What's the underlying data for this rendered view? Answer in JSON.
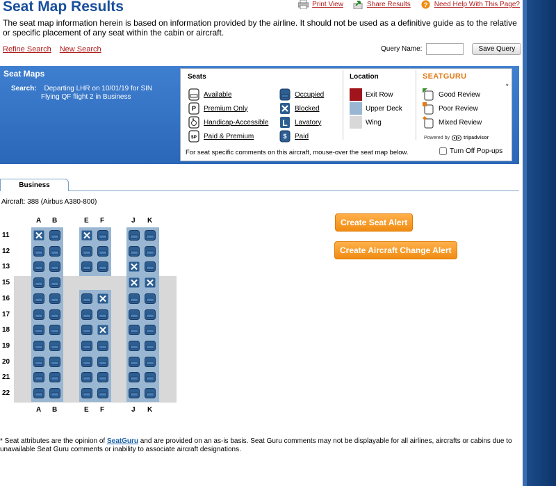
{
  "page": {
    "title": "Seat Map Results",
    "intro": "The seat map information herein is based on information provided by the airline. It should not be used as a definitive guide as to the relative or specific placement of any seat within the cabin or aircraft."
  },
  "top_links": {
    "print": "Print View",
    "share": "Share Results",
    "help": "Need Help With This Page?"
  },
  "search_links": {
    "refine": "Refine Search",
    "new": "New Search"
  },
  "query": {
    "label": "Query Name:",
    "value": "",
    "save": "Save Query"
  },
  "banner": {
    "heading": "Seat Maps",
    "search_label": "Search:",
    "search_line1": "Departing LHR on 10/01/19 for SIN",
    "search_line2": "Flying QF flight 2 in Business"
  },
  "legend": {
    "seats_header": "Seats",
    "location_header": "Location",
    "seats_col1": [
      "Available",
      "Premium Only",
      "Handicap-Accessible",
      "Paid & Premium"
    ],
    "seats_col2": [
      "Occupied",
      "Blocked",
      "Lavatory",
      "Paid"
    ],
    "locations": [
      "Exit Row",
      "Upper Deck",
      "Wing"
    ],
    "location_colors": [
      "#a0141c",
      "#99b6d2",
      "#d8d8d8"
    ],
    "seatguru_logo": "SEATGURU",
    "reviews": [
      "Good Review",
      "Poor Review",
      "Mixed Review"
    ],
    "review_colors": [
      "#3c8f2e",
      "#e07b1a",
      "#e07b1a"
    ],
    "powered_by": "Powered by",
    "tripadvisor": "tripadvisor",
    "asterisk": "*",
    "footer": "For seat specific comments on this aircraft, mouse-over the seat map below.",
    "popups_label": "Turn Off Pop-ups"
  },
  "tab": "Business",
  "aircraft": "Aircraft: 388 (Airbus A380-800)",
  "seatmap": {
    "columns": [
      "A",
      "B",
      "E",
      "F",
      "J",
      "K"
    ],
    "rows": [
      "11",
      "12",
      "13",
      "15",
      "16",
      "17",
      "18",
      "19",
      "20",
      "21",
      "22"
    ],
    "blocked": [
      "11A",
      "11E",
      "13J",
      "15J",
      "15K",
      "16F",
      "18F"
    ],
    "missing": [
      "15E",
      "15F"
    ]
  },
  "alerts": {
    "seat_alert": "Create Seat Alert",
    "aircraft_change": "Create Aircraft Change Alert"
  },
  "footnote": {
    "pre": "* Seat attributes are the opinion of ",
    "link": "SeatGuru",
    "post": " and are provided on an as-is basis. Seat Guru comments may not be displayable for all airlines, aircrafts or cabins due to unavailable Seat Guru comments or inability to associate aircraft designations."
  },
  "colors": {
    "brand_blue": "#1a4f9c",
    "link_red": "#b01c1c",
    "alert_orange": "#f08c12"
  }
}
